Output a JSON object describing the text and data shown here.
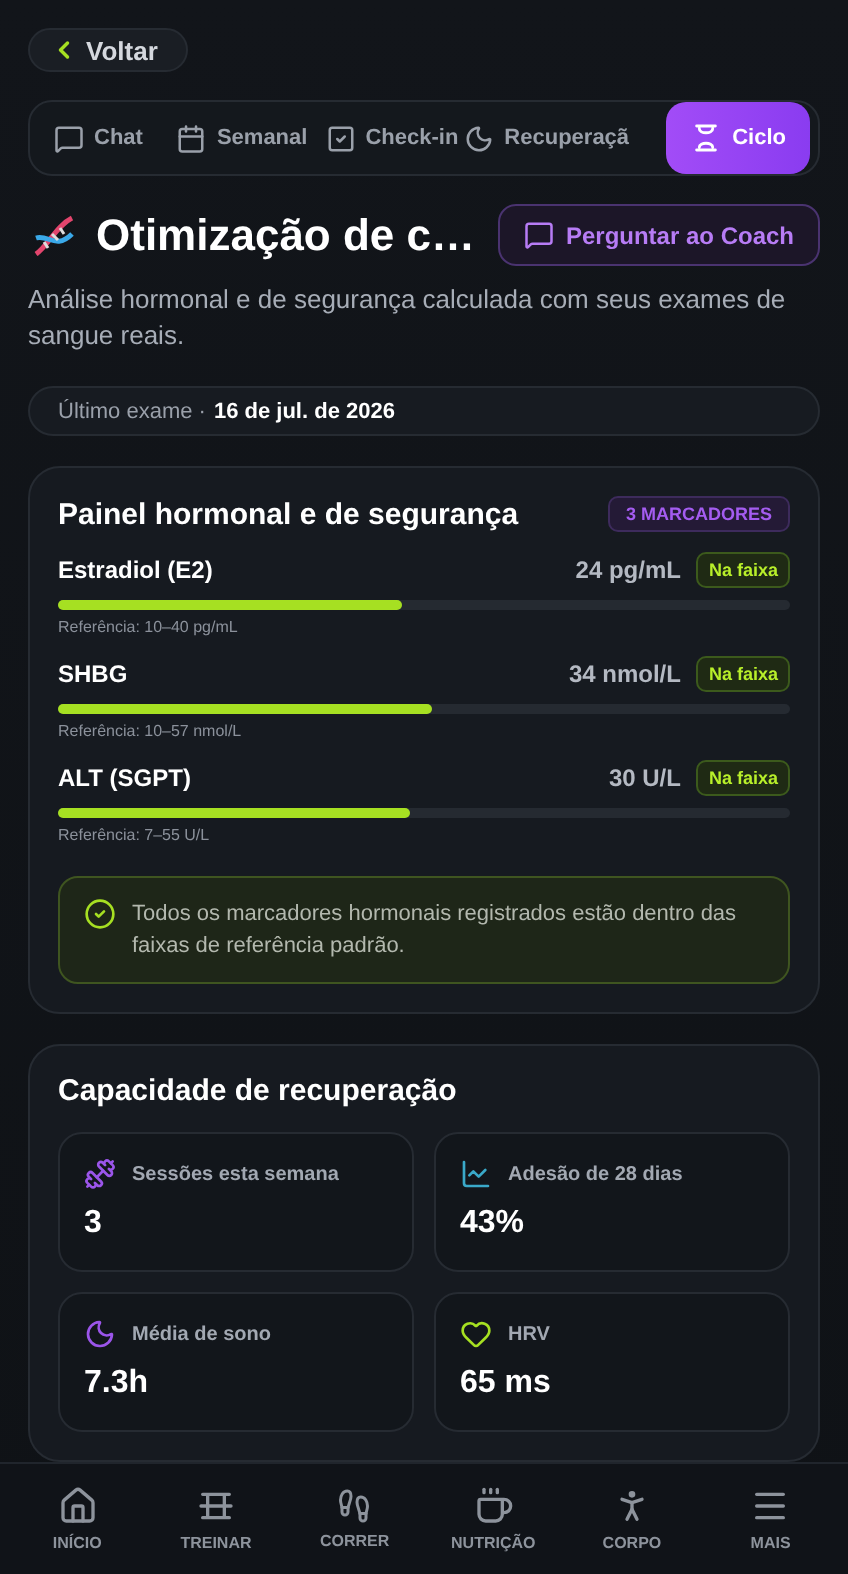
{
  "back_button": {
    "label": "Voltar"
  },
  "tabs": [
    {
      "label": "Chat",
      "selected": false
    },
    {
      "label": "Semanal",
      "selected": false
    },
    {
      "label": "Check-in",
      "selected": false
    },
    {
      "label": "Recuperaçã",
      "selected": false
    },
    {
      "label": "Ciclo",
      "selected": true
    }
  ],
  "header": {
    "title": "Otimização de c…",
    "coach_button": "Perguntar ao Coach",
    "subtitle": "Análise hormonal e de segurança calculada com seus exames de sangue reais."
  },
  "last_exam": {
    "label": "Último exame ·",
    "date": "16 de jul. de 2026"
  },
  "panel": {
    "title": "Painel hormonal e de segurança",
    "badge": "3 MARCADORES",
    "markers": [
      {
        "name": "Estradiol (E2)",
        "value": "24 pg/mL",
        "status": "Na faixa",
        "level": 0.47,
        "reference": "Referência: 10–40 pg/mL"
      },
      {
        "name": "SHBG",
        "value": "34 nmol/L",
        "status": "Na faixa",
        "level": 0.51,
        "reference": "Referência: 10–57 nmol/L"
      },
      {
        "name": "ALT (SGPT)",
        "value": "30 U/L",
        "status": "Na faixa",
        "level": 0.48,
        "reference": "Referência: 7–55 U/L"
      }
    ],
    "note": "Todos os marcadores hormonais registrados estão dentro das faixas de referência padrão."
  },
  "recovery": {
    "title": "Capacidade de recuperação",
    "stats": [
      {
        "label": "Sessões esta semana",
        "value": "3"
      },
      {
        "label": "Adesão de 28 dias",
        "value": "43%"
      },
      {
        "label": "Média de sono",
        "value": "7.3h"
      },
      {
        "label": "HRV",
        "value": "65 ms"
      }
    ]
  },
  "bottom_nav": [
    {
      "label": "INÍCIO",
      "selected": false
    },
    {
      "label": "TREINAR",
      "selected": false
    },
    {
      "label": "CORRER",
      "selected": false
    },
    {
      "label": "NUTRIÇÃO",
      "selected": false
    },
    {
      "label": "CORPO",
      "selected": false
    },
    {
      "label": "MAIS",
      "selected": false
    }
  ]
}
